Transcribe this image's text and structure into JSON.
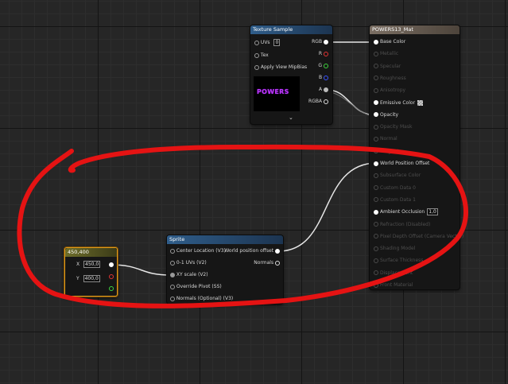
{
  "texture_node": {
    "title": "Texture Sample",
    "inputs": [
      {
        "label": "UVs",
        "value": "0"
      },
      {
        "label": "Tex",
        "value": ""
      },
      {
        "label": "Apply View MipBias",
        "value": ""
      }
    ],
    "outputs": [
      "RGB",
      "R",
      "G",
      "B",
      "A",
      "RGBA"
    ],
    "thumbnail_text": "POWERS"
  },
  "material_node": {
    "title": "POWERS13_Mat",
    "inputs": [
      {
        "label": "Base Color",
        "active": true
      },
      {
        "label": "Metallic",
        "active": false
      },
      {
        "label": "Specular",
        "active": false
      },
      {
        "label": "Roughness",
        "active": false
      },
      {
        "label": "Anisotropy",
        "active": false
      },
      {
        "label": "Emissive Color",
        "active": true
      },
      {
        "label": "Opacity",
        "active": true
      },
      {
        "label": "Opacity Mask",
        "active": false
      },
      {
        "label": "Normal",
        "active": false
      },
      {
        "label": "Tangent",
        "active": false
      },
      {
        "label": "World Position Offset",
        "active": true
      },
      {
        "label": "Subsurface Color",
        "active": false
      },
      {
        "label": "Custom Data 0",
        "active": false
      },
      {
        "label": "Custom Data 1",
        "active": false
      },
      {
        "label": "Ambient Occlusion",
        "active": true,
        "value": "1,0"
      },
      {
        "label": "Refraction (Disabled)",
        "active": false
      },
      {
        "label": "Pixel Depth Offset (Camera Vector)",
        "active": false
      },
      {
        "label": "Shading Model",
        "active": false
      },
      {
        "label": "Surface Thickness",
        "active": false
      },
      {
        "label": "Displacement",
        "active": false
      },
      {
        "label": "Front Material",
        "active": false
      }
    ]
  },
  "sprite_node": {
    "title": "Sprite",
    "inputs": [
      "Center Location (V3)",
      "0-1 UVs (V2)",
      "XY scale (V2)",
      "Override Pivot (SS)",
      "Normals (Optional) (V3)"
    ],
    "outputs": [
      "World position offset",
      "Normals"
    ]
  },
  "constant_node": {
    "title": "450,400",
    "x_label": "X",
    "x_value": "450,0",
    "y_label": "Y",
    "y_value": "400,0"
  },
  "colors": {
    "grid_bg": "#262626",
    "node_body": "#161616",
    "function_header": "#2f5d8a",
    "material_header": "#7a6e63",
    "constant_border": "#e09a1c",
    "annotation_red": "#e51313",
    "wire": "#e6e6e6"
  }
}
